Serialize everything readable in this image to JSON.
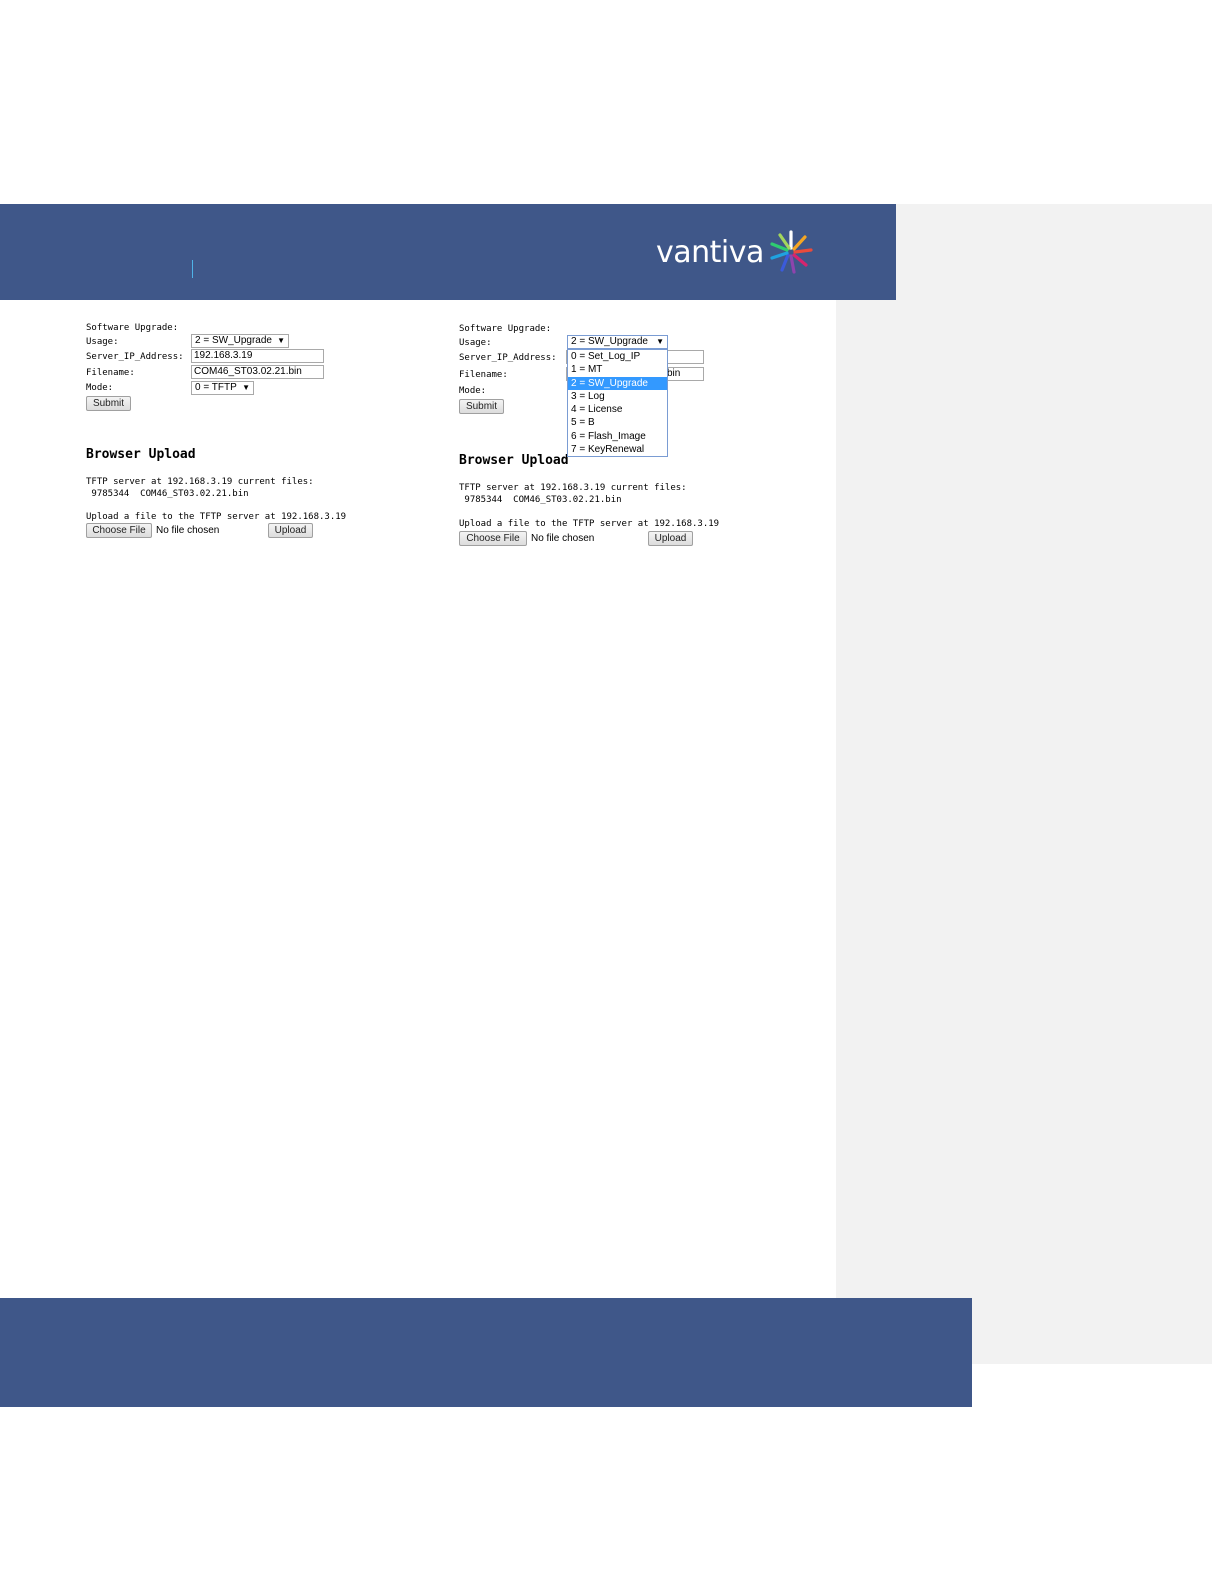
{
  "brand": {
    "name": "vantiva"
  },
  "left": {
    "section_label": "Software Upgrade:",
    "usage_label": "Usage:",
    "usage_value": "2 = SW_Upgrade",
    "server_ip_label": "Server_IP_Address:",
    "server_ip_value": "192.168.3.19",
    "filename_label": "Filename:",
    "filename_value": "COM46_ST03.02.21.bin",
    "mode_label": "Mode:",
    "mode_value": "0 = TFTP",
    "submit_label": "Submit",
    "browser_upload_title": "Browser Upload",
    "tftp_files_text": "TFTP server at 192.168.3.19 current files:",
    "file_entry": " 9785344  COM46_ST03.02.21.bin",
    "upload_prompt": "Upload a file to the TFTP server at 192.168.3.19",
    "choose_file_label": "Choose File",
    "no_file_text": "No file chosen",
    "upload_label": "Upload"
  },
  "right": {
    "section_label": "Software Upgrade:",
    "usage_label": "Usage:",
    "usage_value": "2 = SW_Upgrade",
    "server_ip_label": "Server_IP_Address:",
    "filename_label": "Filename:",
    "filename_partial": "bin",
    "mode_label": "Mode:",
    "submit_label": "Submit",
    "dropdown_options": [
      "0 = Set_Log_IP",
      "1 = MT",
      "2 = SW_Upgrade",
      "3 = Log",
      "4 = License",
      "5 = B",
      "6 = Flash_Image",
      "7 = KeyRenewal"
    ],
    "selected_option": "2 = SW_Upgrade",
    "browser_upload_title": "Browser Upload",
    "tftp_files_text": "TFTP server at 192.168.3.19 current files:",
    "file_entry": " 9785344  COM46_ST03.02.21.bin",
    "upload_prompt": "Upload a file to the TFTP server at 192.168.3.19",
    "choose_file_label": "Choose File",
    "no_file_text": "No file chosen",
    "upload_label": "Upload"
  },
  "colors": {
    "band": "#3f5789",
    "panel": "#f2f2f2",
    "highlight": "#3399ff"
  }
}
